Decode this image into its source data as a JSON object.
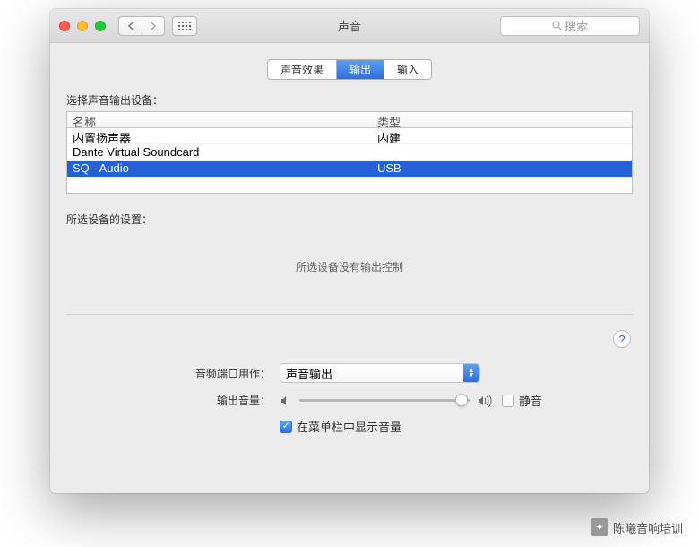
{
  "window_title": "声音",
  "search_placeholder": "搜索",
  "tabs": {
    "effects": "声音效果",
    "output": "输出",
    "input": "输入"
  },
  "device_list_label": "选择声音输出设备：",
  "columns": {
    "name": "名称",
    "type": "类型"
  },
  "devices": [
    {
      "name": "内置扬声器",
      "type": "内建",
      "selected": false
    },
    {
      "name": "Dante Virtual Soundcard",
      "type": "",
      "selected": false
    },
    {
      "name": "SQ - Audio",
      "type": "USB",
      "selected": true
    }
  ],
  "settings_label": "所选设备的设置：",
  "no_output_controls": "所选设备没有输出控制",
  "port_label": "音频端口用作：",
  "port_value": "声音输出",
  "volume_label": "输出音量：",
  "mute_label": "静音",
  "menubar_label": "在菜单栏中显示音量",
  "footer_text": "陈曦音响培训"
}
